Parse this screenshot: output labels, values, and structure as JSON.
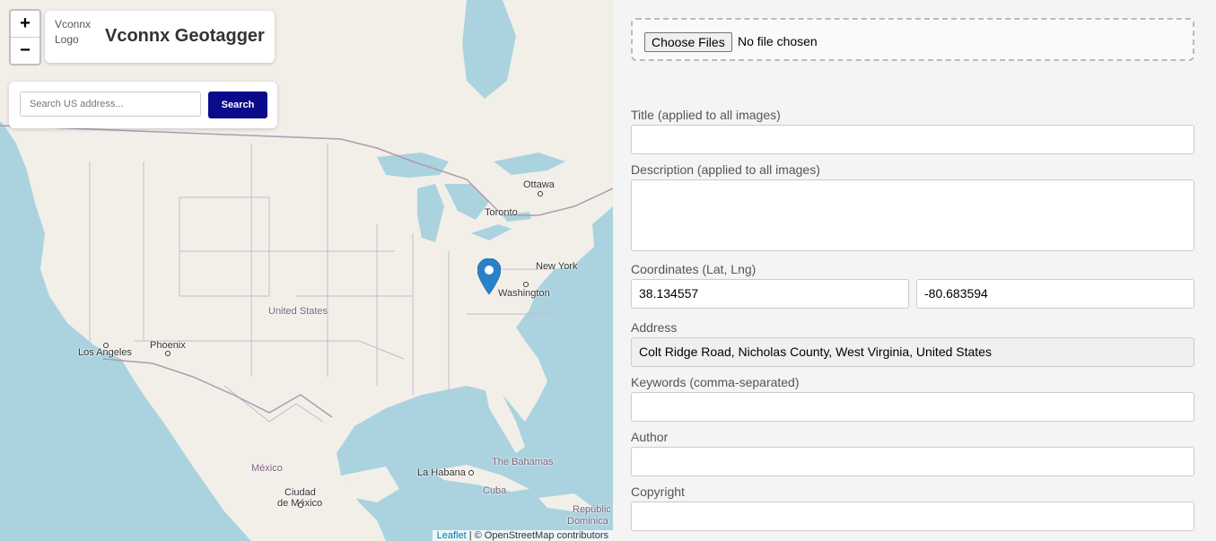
{
  "brand": {
    "logo_alt": "Vconnx Logo",
    "title": "Vconnx Geotagger"
  },
  "map": {
    "zoom_in": "+",
    "zoom_out": "−",
    "search": {
      "placeholder": "Search US address...",
      "button": "Search"
    },
    "labels": {
      "ottawa": "Ottawa",
      "toronto": "Toronto",
      "new_york": "New York",
      "washington": "Washington",
      "united_states": "United States",
      "phoenix": "Phoenix",
      "los_angeles": "Los Angeles",
      "mexico": "México",
      "ciudad_de_mexico_1": "Ciudad",
      "ciudad_de_mexico_2": "de México",
      "la_habana": "La Habana",
      "the_bahamas": "The Bahamas",
      "cuba": "Cuba",
      "republica_1": "Repúblic",
      "republica_2": "Dominica"
    },
    "attribution": {
      "leaflet": "Leaflet",
      "rest": " | © OpenStreetMap contributors"
    },
    "colors": {
      "water": "#aad3df",
      "land": "#f2efe9",
      "marker": "#2a81cb",
      "search_button": "#0a0a8a"
    }
  },
  "form": {
    "file_button": "Choose Files",
    "file_status": "No file chosen",
    "title_label": "Title (applied to all images)",
    "title_value": "",
    "description_label": "Description (applied to all images)",
    "description_value": "",
    "coords_label": "Coordinates (Lat, Lng)",
    "lat": "38.134557",
    "lng": "-80.683594",
    "address_label": "Address",
    "address_value": "Colt Ridge Road, Nicholas County, West Virginia, United States",
    "keywords_label": "Keywords (comma-separated)",
    "keywords_value": "",
    "author_label": "Author",
    "author_value": "",
    "copyright_label": "Copyright",
    "copyright_value": ""
  }
}
